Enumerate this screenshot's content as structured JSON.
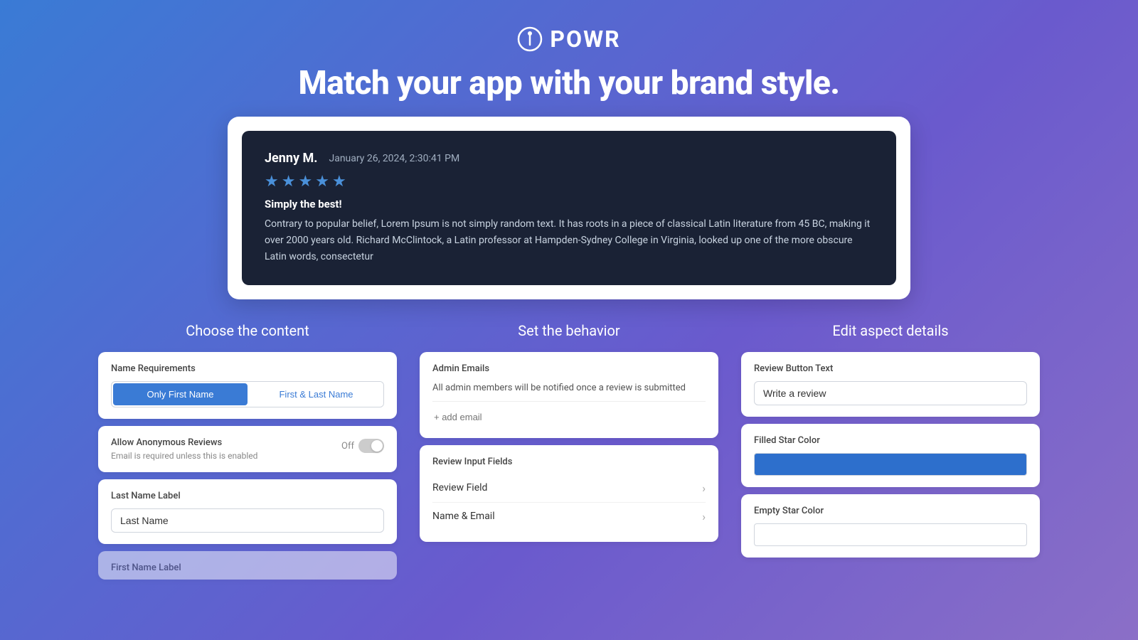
{
  "header": {
    "logo_text": "POWR",
    "headline": "Match your app with your brand style."
  },
  "review_card": {
    "reviewer": "Jenny M.",
    "date": "January 26, 2024, 2:30:41 PM",
    "stars": 5,
    "title": "Simply the best!",
    "body": "Contrary to popular belief, Lorem Ipsum is not simply random text. It has roots in a piece of classical Latin literature from 45 BC, making it over 2000 years old. Richard McClintock, a Latin professor at Hampden-Sydney College in Virginia, looked up one of the more obscure Latin words, consectetur"
  },
  "content_column": {
    "title": "Choose the content",
    "name_requirements": {
      "label": "Name Requirements",
      "option1": "Only First Name",
      "option2": "First & Last Name"
    },
    "anonymous_reviews": {
      "label": "Allow Anonymous Reviews",
      "sublabel": "Email is required unless this is enabled",
      "toggle_state": "Off"
    },
    "last_name_label": {
      "label": "Last Name Label",
      "value": "Last Name"
    },
    "first_name_label": {
      "label": "First Name Label"
    }
  },
  "behavior_column": {
    "title": "Set the behavior",
    "admin_emails": {
      "label": "Admin Emails",
      "description": "All admin members will be notified once a review is submitted",
      "add_placeholder": "+ add email"
    },
    "review_input_fields": {
      "label": "Review Input Fields",
      "fields": [
        {
          "name": "Review Field"
        },
        {
          "name": "Name & Email"
        }
      ]
    }
  },
  "aspect_column": {
    "title": "Edit aspect details",
    "review_button_text": {
      "label": "Review Button Text",
      "value": "Write a review"
    },
    "filled_star_color": {
      "label": "Filled Star Color",
      "color": "#2d6fcc"
    },
    "empty_star_color": {
      "label": "Empty Star Color",
      "color": "#ffffff"
    }
  }
}
